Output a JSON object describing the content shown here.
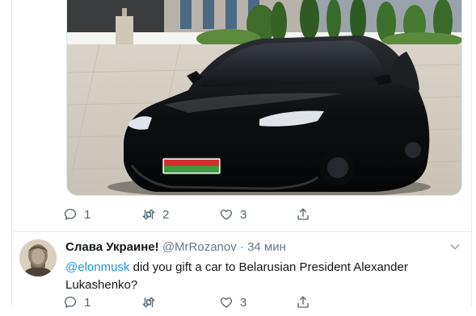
{
  "tweet1": {
    "actions": {
      "reply_count": "1",
      "retweet_count": "2",
      "like_count": "3"
    }
  },
  "tweet2": {
    "display_name": "Слава Украине!",
    "handle": "@MrRozanov",
    "separator": "·",
    "timestamp": "34 мин",
    "mention": "@elonmusk",
    "text": " did you gift a car to Belarusian President Alexander Lukashenko?",
    "actions": {
      "reply_count": "1",
      "like_count": "3"
    }
  },
  "colors": {
    "link": "#1b95e0",
    "icon_gray": "#536471",
    "border": "#e6ecf0"
  },
  "icons": [
    "reply-icon",
    "retweet-icon",
    "like-icon",
    "share-icon",
    "chevron-down-icon"
  ]
}
